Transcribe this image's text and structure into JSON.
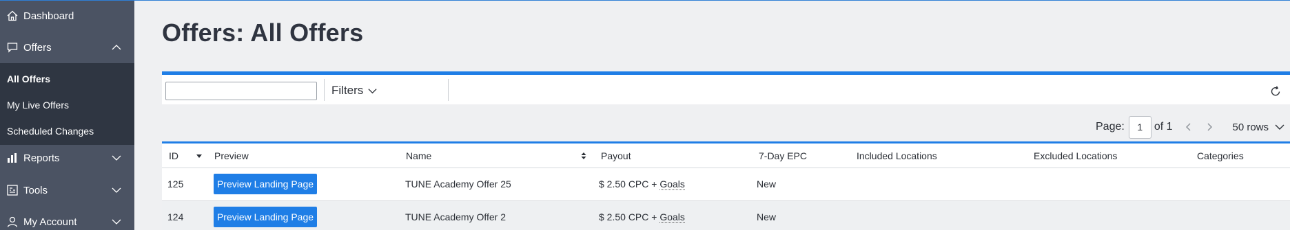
{
  "sidebar": {
    "items": [
      {
        "label": "Dashboard",
        "icon": "home-icon"
      },
      {
        "label": "Offers",
        "icon": "chat-icon",
        "expanded": true
      },
      {
        "label": "Reports",
        "icon": "chart-icon"
      },
      {
        "label": "Tools",
        "icon": "tools-icon"
      },
      {
        "label": "My Account",
        "icon": "user-icon"
      }
    ],
    "sub_items": [
      {
        "label": "All Offers",
        "active": true
      },
      {
        "label": "My Live Offers"
      },
      {
        "label": "Scheduled Changes"
      }
    ]
  },
  "page": {
    "title": "Offers: All Offers"
  },
  "toolbar": {
    "search_value": "",
    "filters_label": "Filters"
  },
  "pager": {
    "page_label": "Page:",
    "page_value": "1",
    "of_label": "of 1",
    "rows_label": "50 rows"
  },
  "table": {
    "columns": [
      "ID",
      "Preview",
      "Name",
      "Payout",
      "7-Day EPC",
      "Included Locations",
      "Excluded Locations",
      "Categories"
    ],
    "rows": [
      {
        "id": "125",
        "preview": "Preview Landing Page",
        "name": "TUNE Academy Offer 25",
        "payout": "$ 2.50 CPC + ",
        "goals": "Goals",
        "epc": "New"
      },
      {
        "id": "124",
        "preview": "Preview Landing Page",
        "name": "TUNE Academy Offer 2",
        "payout": "$ 2.50 CPC + ",
        "goals": "Goals",
        "epc": "New"
      }
    ]
  },
  "colors": {
    "accent": "#1f7ee6",
    "sidebar": "#4b5363",
    "subnav": "#2f3642"
  }
}
